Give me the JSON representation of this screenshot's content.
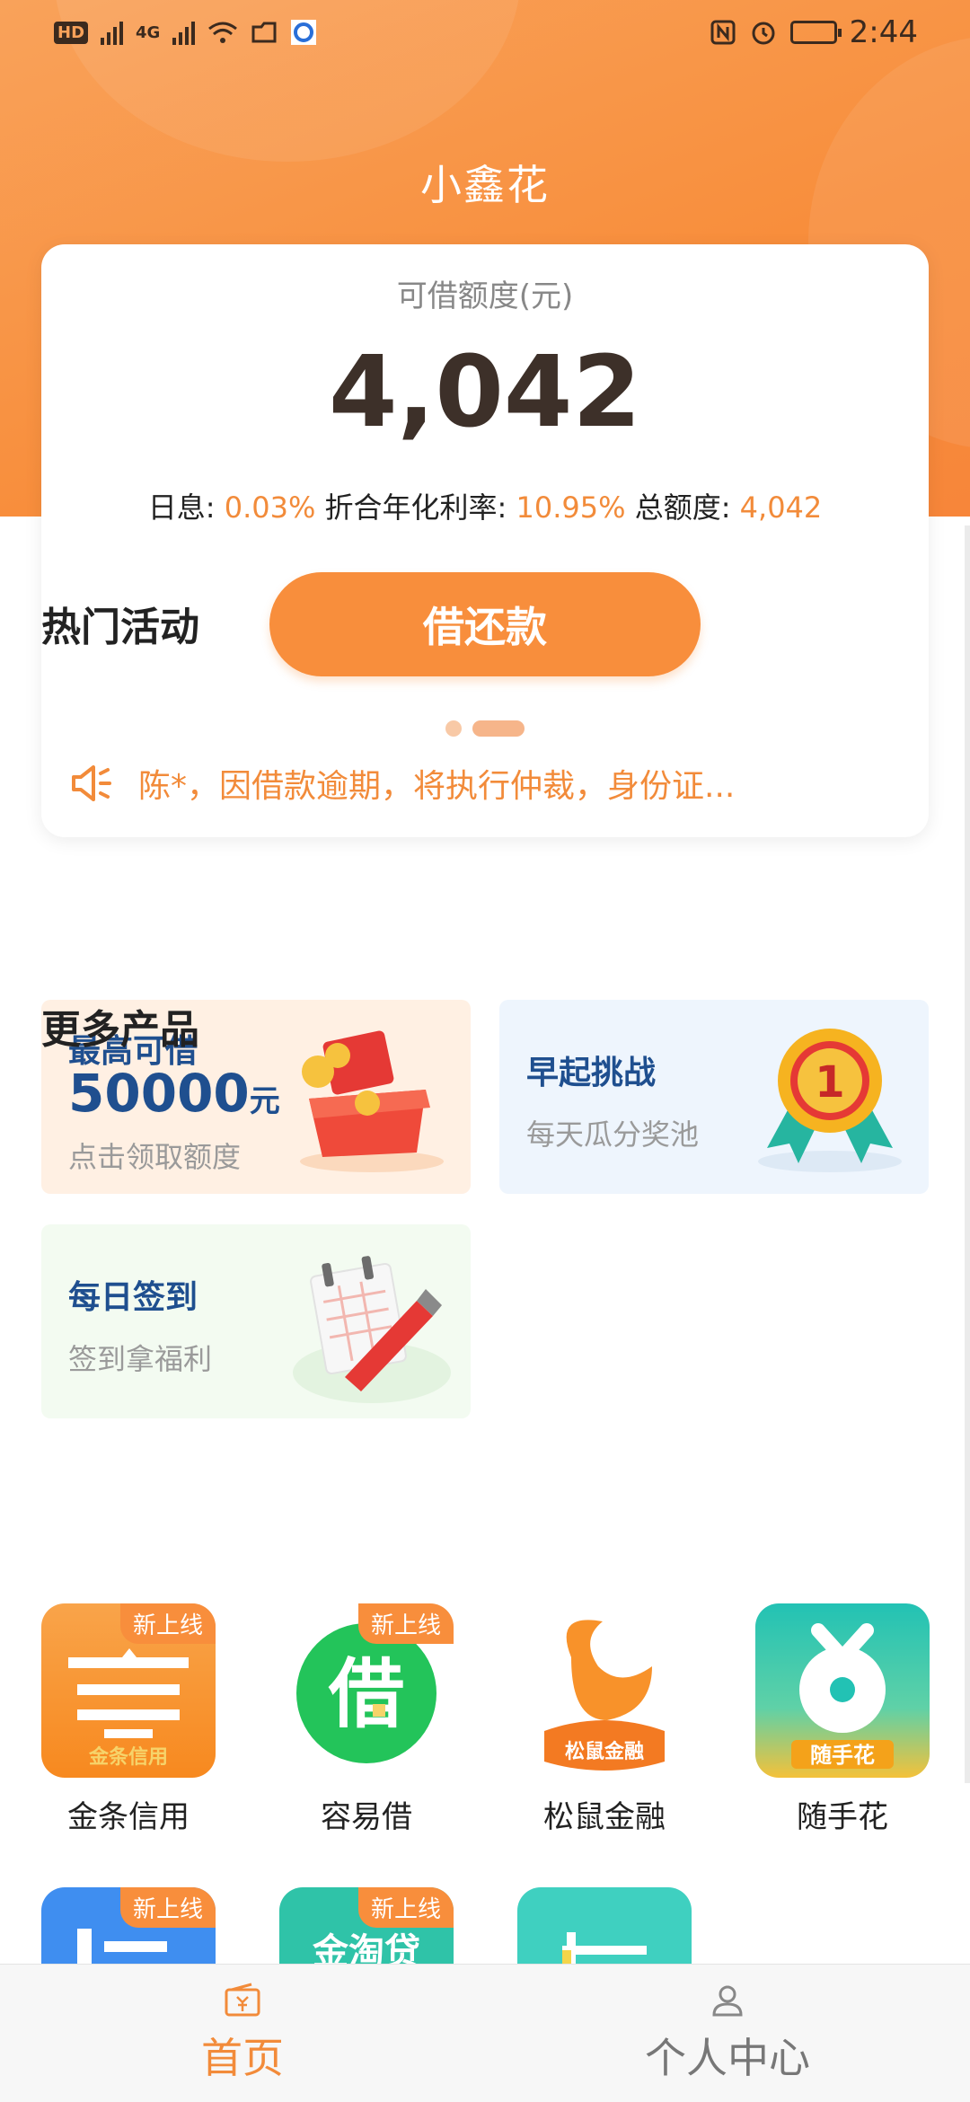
{
  "status_bar": {
    "hd": "HD",
    "time": "2:44",
    "network": "4G"
  },
  "header": {
    "title": "小鑫花"
  },
  "credit": {
    "label": "可借额度(元)",
    "amount": "4,042",
    "daily_rate_label": "日息: ",
    "daily_rate": "0.03%",
    "annual_rate_label": " 折合年化利率: ",
    "annual_rate": "10.95%",
    "total_label": " 总额度: ",
    "total": "4,042",
    "button": "借还款",
    "notice": "陈*，因借款逾期，将执行仲裁，身份证..."
  },
  "activities": {
    "title": "热门活动",
    "items": [
      {
        "title": "最高可借",
        "big": "50000",
        "unit": "元",
        "subtitle": "点击领取额度"
      },
      {
        "title": "早起挑战",
        "subtitle": "每天瓜分奖池"
      },
      {
        "title": "每日签到",
        "subtitle": "签到拿福利"
      }
    ]
  },
  "products": {
    "title": "更多产品",
    "badge": "新上线",
    "items": [
      {
        "name": "金条信用",
        "icon_text": "金条信用"
      },
      {
        "name": "容易借",
        "icon_text": "借"
      },
      {
        "name": "松鼠金融",
        "icon_text": "松鼠金融"
      },
      {
        "name": "随手花",
        "icon_text": "随手花"
      }
    ],
    "row2_icon_texts": [
      "",
      "金淘贷",
      ""
    ]
  },
  "tabbar": {
    "home": "首页",
    "profile": "个人中心"
  },
  "colors": {
    "accent": "#f88e3c",
    "activity_title": "#1f4f8f"
  }
}
